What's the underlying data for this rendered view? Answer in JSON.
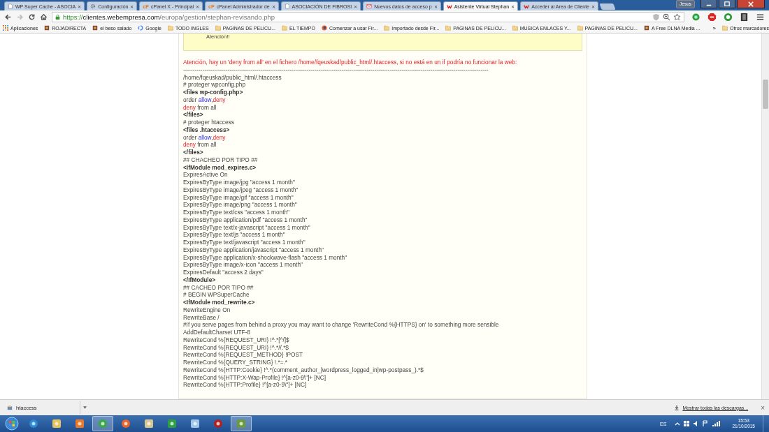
{
  "tabs": [
    {
      "title": "WP Super Cache - ASOCIA",
      "kind": "page",
      "close": "✕",
      "selected": false
    },
    {
      "title": "Configuración",
      "kind": "gear",
      "close": "✕",
      "selected": false
    },
    {
      "title": "cPanel X - Principal",
      "kind": "cpanel",
      "badge": "cP",
      "close": "✕",
      "selected": false
    },
    {
      "title": "cPanel Administrador de",
      "kind": "cpanel",
      "badge": "cP",
      "close": "✕",
      "selected": false
    },
    {
      "title": "ASOCIACIÓN DE FIBROSI",
      "kind": "page",
      "close": "✕",
      "selected": false
    },
    {
      "title": "Nuevos datos de acceso p",
      "kind": "mail",
      "close": "✕",
      "selected": false
    },
    {
      "title": "Asistente Virtual Stephan",
      "kind": "brand",
      "close": "✕",
      "selected": true
    },
    {
      "title": "Acceder al Area de Cliente",
      "kind": "brand",
      "close": "✕",
      "selected": false
    }
  ],
  "user": "Jesus",
  "address": {
    "scheme": "https://",
    "host": "clientes.webempresa.com",
    "path": "/europa/gestion/stephan-revisando.php"
  },
  "bookmarks": [
    {
      "label": "Aplicaciones",
      "kind": "apps"
    },
    {
      "label": "ROJADIRECTA",
      "kind": "site"
    },
    {
      "label": "el beso salado",
      "kind": "site"
    },
    {
      "label": "Google",
      "kind": "google"
    },
    {
      "label": "TODO INGLES",
      "kind": "folder"
    },
    {
      "label": "PAGINAS DE PELICU...",
      "kind": "folder"
    },
    {
      "label": "EL TIEMPO",
      "kind": "folder"
    },
    {
      "label": "Comenzar a usar Fir...",
      "kind": "firefox"
    },
    {
      "label": "Importado desde Fir...",
      "kind": "folder"
    },
    {
      "label": "PAGINAS DE PELICU...",
      "kind": "folder"
    },
    {
      "label": "MUSICA ENLACES Y...",
      "kind": "folder"
    },
    {
      "label": "PAGINAS DE PELICU...",
      "kind": "folder"
    },
    {
      "label": "A Free DLNA Media ...",
      "kind": "site"
    }
  ],
  "bookmarks_more": "»",
  "other_bookmarks": "Otros marcadores",
  "notice": "Atención!!",
  "lines": [
    {
      "kind": "warning",
      "text": "Atención, hay un 'deny from all' en el fichero /home/fqeuskad/public_html/.htaccess, si no está en un if podría no funcionar la web:"
    },
    {
      "kind": "plain",
      "text": "--------------------------------------------------------------------------------------------------------------------------------------------------------------"
    },
    {
      "kind": "plain",
      "text": "/home/fqeuskad/public_html/.htaccess"
    },
    {
      "kind": "plain",
      "text": "# proteger wpconfig.php"
    },
    {
      "kind": "tag",
      "text": "<files wp-config.php>"
    },
    {
      "kind": "mixed",
      "parts": [
        {
          "kind": "plain",
          "text": "order "
        },
        {
          "kind": "allow",
          "text": "allow"
        },
        {
          "kind": "plain",
          "text": ","
        },
        {
          "kind": "deny",
          "text": "deny"
        }
      ]
    },
    {
      "kind": "mixed",
      "parts": [
        {
          "kind": "deny",
          "text": "deny"
        },
        {
          "kind": "plain",
          "text": " from all"
        }
      ]
    },
    {
      "kind": "tag",
      "text": "</files>"
    },
    {
      "kind": "plain",
      "text": "# proteger htaccess"
    },
    {
      "kind": "tag",
      "text": "<files .htaccess>"
    },
    {
      "kind": "mixed",
      "parts": [
        {
          "kind": "plain",
          "text": "order "
        },
        {
          "kind": "allow",
          "text": "allow"
        },
        {
          "kind": "plain",
          "text": ","
        },
        {
          "kind": "deny",
          "text": "deny"
        }
      ]
    },
    {
      "kind": "mixed",
      "parts": [
        {
          "kind": "deny",
          "text": "deny"
        },
        {
          "kind": "plain",
          "text": " from all"
        }
      ]
    },
    {
      "kind": "tag",
      "text": "</files>"
    },
    {
      "kind": "plain",
      "text": "## CHACHEO POR TIPO ##"
    },
    {
      "kind": "tag",
      "text": "<IfModule mod_expires.c>"
    },
    {
      "kind": "plain",
      "text": "ExpiresActive On"
    },
    {
      "kind": "plain",
      "text": "ExpiresByType image/jpg \"access 1 month\""
    },
    {
      "kind": "plain",
      "text": "ExpiresByType image/jpeg \"access 1 month\""
    },
    {
      "kind": "plain",
      "text": "ExpiresByType image/gif \"access 1 month\""
    },
    {
      "kind": "plain",
      "text": "ExpiresByType image/png \"access 1 month\""
    },
    {
      "kind": "plain",
      "text": "ExpiresByType text/css \"access 1 month\""
    },
    {
      "kind": "plain",
      "text": "ExpiresByType application/pdf \"access 1 month\""
    },
    {
      "kind": "plain",
      "text": "ExpiresByType text/x-javascript \"access 1 month\""
    },
    {
      "kind": "plain",
      "text": "ExpiresByType text/js \"access 1 month\""
    },
    {
      "kind": "plain",
      "text": "ExpiresByType text/javascript \"access 1 month\""
    },
    {
      "kind": "plain",
      "text": "ExpiresByType application/javascript \"access 1 month\""
    },
    {
      "kind": "plain",
      "text": "ExpiresByType application/x-shockwave-flash \"access 1 month\""
    },
    {
      "kind": "plain",
      "text": "ExpiresByType image/x-icon \"access 1 month\""
    },
    {
      "kind": "plain",
      "text": "ExpiresDefault \"access 2 days\""
    },
    {
      "kind": "tag",
      "text": "</IfModule>"
    },
    {
      "kind": "plain",
      "text": "## CACHEO POR TIPO ##"
    },
    {
      "kind": "plain",
      "text": "# BEGIN WPSuperCache"
    },
    {
      "kind": "tag",
      "text": "<IfModule mod_rewrite.c>"
    },
    {
      "kind": "plain",
      "text": "RewriteEngine On"
    },
    {
      "kind": "plain",
      "text": "RewriteBase /"
    },
    {
      "kind": "plain",
      "text": "#If you serve pages from behind a proxy you may want to change 'RewriteCond %{HTTPS} on' to something more sensible"
    },
    {
      "kind": "plain",
      "text": "AddDefaultCharset UTF-8"
    },
    {
      "kind": "plain",
      "text": "RewriteCond %{REQUEST_URI} !^.*[^/]$"
    },
    {
      "kind": "plain",
      "text": "RewriteCond %{REQUEST_URI} !^.*//.*$"
    },
    {
      "kind": "plain",
      "text": "RewriteCond %{REQUEST_METHOD} !POST"
    },
    {
      "kind": "plain",
      "text": "RewriteCond %{QUERY_STRING} !.*=.*"
    },
    {
      "kind": "plain",
      "text": "RewriteCond %{HTTP:Cookie} !^.*(comment_author_|wordpress_logged_in|wp-postpass_).*$"
    },
    {
      "kind": "plain",
      "text": "RewriteCond %{HTTP:X-Wap-Profile} !^[a-z0-9\\\"]+ [NC]"
    },
    {
      "kind": "plain",
      "text": "RewriteCond %{HTTP:Profile} !^[a-z0-9\\\"]+ [NC]"
    }
  ],
  "download": {
    "file": "htaccess",
    "show_all": "Mostrar todas las descargas...",
    "close": "×"
  },
  "taskbar": {
    "apps": [
      {
        "kind": "ie",
        "selected": false
      },
      {
        "kind": "folder",
        "selected": false
      },
      {
        "kind": "media",
        "selected": false
      },
      {
        "kind": "chrome",
        "selected": true
      },
      {
        "kind": "firefox",
        "selected": false
      },
      {
        "kind": "files",
        "selected": false
      },
      {
        "kind": "torrent",
        "selected": false
      },
      {
        "kind": "notes",
        "selected": false
      },
      {
        "kind": "game",
        "selected": false
      },
      {
        "kind": "chart",
        "selected": true
      }
    ],
    "language": "ES",
    "time": "15:53",
    "date": "21/10/2015"
  }
}
